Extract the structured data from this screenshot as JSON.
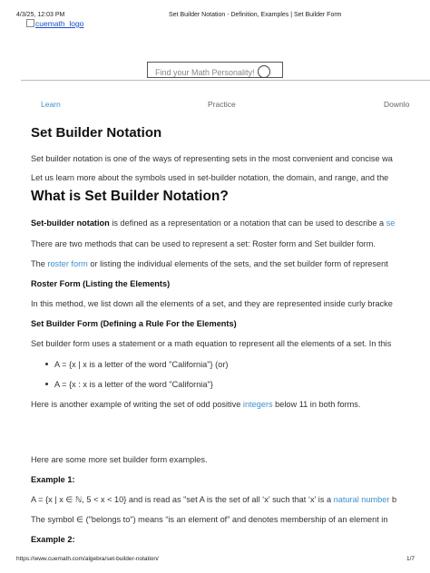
{
  "print_header": {
    "datetime": "4/3/25, 12:03 PM",
    "title": "Set Builder Notation - Definition, Examples | Set Builder Form"
  },
  "logo_alt": "cuemath_logo",
  "search": {
    "placeholder": "Find your Math Personality!"
  },
  "nav": {
    "learn": "Learn",
    "practice": "Practice",
    "download": "Downlo"
  },
  "title": "Set Builder Notation",
  "intro": [
    "Set builder notation is one of the ways of representing sets in the most convenient and concise wa",
    "Let us learn more about the symbols used in set-builder notation, the domain, and range, and the"
  ],
  "section_heading": "What is Set Builder Notation?",
  "definition": {
    "bold": "Set-builder notation",
    "text": " is defined as a representation or a notation that can be used to describe a ",
    "link": "se"
  },
  "methods_text": "There are two methods that can be used to represent a set: Roster form and Set builder form.",
  "roster_line": {
    "prefix": "The ",
    "link": "roster form",
    "text": " or listing the individual elements of the sets, and the set builder form of represent"
  },
  "roster_heading": "Roster Form (Listing the Elements)",
  "roster_text": "In this method, we list down all the elements of a set, and they are represented inside curly bracke",
  "builder_heading": "Set Builder Form (Defining a Rule For the Elements)",
  "builder_text": "Set builder form uses a statement or a math equation to represent all the elements of a set. In this",
  "bullets": [
    "A = {x | x is a letter of the word \"California\"} (or)",
    "A = {x : x is a letter of the word \"California\"}"
  ],
  "odd_line": {
    "prefix": "Here is another example of writing the set of odd positive ",
    "link": "integers",
    "suffix": " below 11 in both forms."
  },
  "more_examples": "Here are some more set builder form examples.",
  "example1": {
    "heading": "Example 1:",
    "line_prefix": "A = {x | x ∈ ℕ, 5 < x < 10} and is read as \"set A is the set of all ‘x’ such that ‘x’ is a ",
    "link": "natural number",
    "line_suffix": " b",
    "symbol_line": "The symbol ∈ (\"belongs to\") means “is an element of” and denotes membership of an element in"
  },
  "example2": {
    "heading": "Example 2:"
  },
  "footer": {
    "url": "https://www.cuemath.com/algebra/set-builder-notation/",
    "page": "1/7"
  }
}
